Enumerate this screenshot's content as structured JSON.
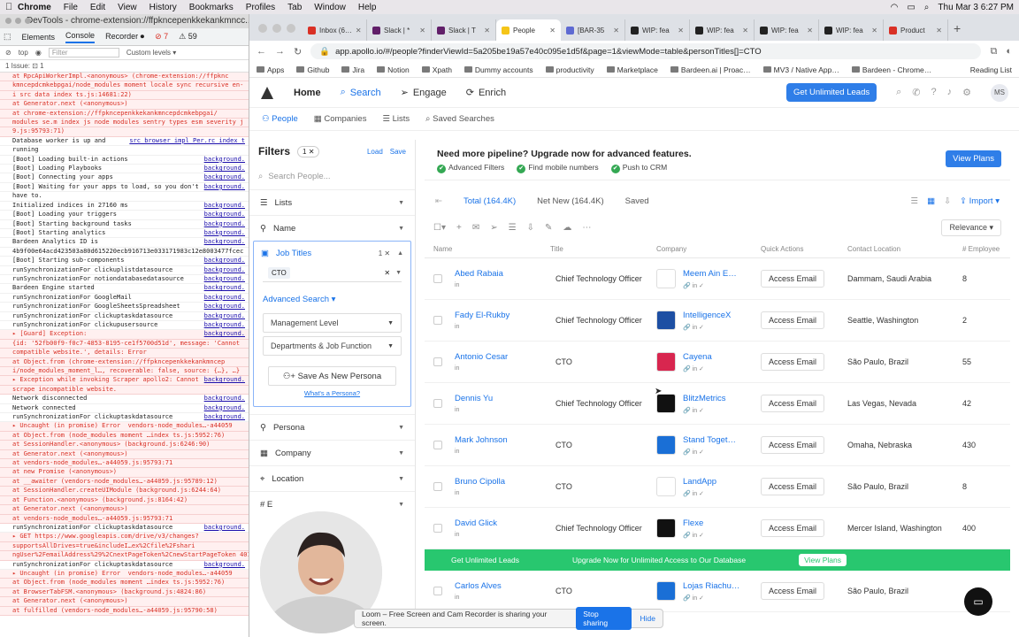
{
  "menubar": {
    "app": "Chrome",
    "items": [
      "File",
      "Edit",
      "View",
      "History",
      "Bookmarks",
      "Profiles",
      "Tab",
      "Window",
      "Help"
    ],
    "clock": "Thu Mar 3  6:27 PM"
  },
  "devtools": {
    "title": "DevTools - chrome-extension://ffpkncepenkkekankmncc...",
    "tabs": [
      "Elements",
      "Console",
      "Recorder ⏺"
    ],
    "active_tab": "Console",
    "error_count": "⊘ 7",
    "warn_count": "⚠ 59",
    "top": "top",
    "filter_placeholder": "Filter",
    "levels": "Custom levels ▾",
    "issues": "1 Issue: ⊡ 1",
    "log": [
      {
        "text": "at RpcApiWorkerImpl.<anonymous> (chrome-extension://ffpknc",
        "src": "",
        "err": true
      },
      {
        "text": "kmncepdcmkebpgai/node_modules moment locale sync recursive en-",
        "src": "",
        "err": true
      },
      {
        "text": "i src data index ts.js:14681:22)",
        "src": "",
        "err": true
      },
      {
        "text": "at Generator.next (<anonymous>)",
        "src": "",
        "err": true
      },
      {
        "text": "at chrome-extension://ffpkncepenkkekankmncepdcmkebpgai/",
        "src": "",
        "err": true
      },
      {
        "text": "modules se.m index js node modules sentry types esm severity j",
        "src": "",
        "err": true
      },
      {
        "text": "9.js:95793:71)",
        "src": "",
        "err": true
      },
      {
        "text": "Database worker is up and",
        "src": "src browser impl Per.rc index t",
        "err": false
      },
      {
        "text": "running",
        "src": "",
        "err": false
      },
      {
        "text": "[Boot] Loading built-in actions",
        "src": "background.",
        "err": false
      },
      {
        "text": "[Boot] Loading Playbooks",
        "src": "background.",
        "err": false
      },
      {
        "text": "[Boot] Connecting your apps",
        "src": "background.",
        "err": false
      },
      {
        "text": "[Boot] Waiting for your apps to load, so you don't",
        "src": "background.",
        "err": false
      },
      {
        "text": "have to.",
        "src": "",
        "err": false
      },
      {
        "text": "Initialized indices in 27160 ms",
        "src": "background.",
        "err": false
      },
      {
        "text": "[Boot] Loading your triggers",
        "src": "background.",
        "err": false
      },
      {
        "text": "[Boot] Starting background tasks",
        "src": "background.",
        "err": false
      },
      {
        "text": "[Boot] Starting analytics",
        "src": "background.",
        "err": false
      },
      {
        "text": "Bardeen Analytics ID is",
        "src": "background.",
        "err": false
      },
      {
        "text": "4b9f00e64acd423503a80d615220ecb916713e033171983c12e8003477fcec",
        "src": "",
        "err": false
      },
      {
        "text": "[Boot] Starting sub-components",
        "src": "background.",
        "err": false
      },
      {
        "text": "runSynchronizationFor clickuplistdatasource",
        "src": "background.",
        "err": false
      },
      {
        "text": "runSynchronizationFor notiondatabasedatasource",
        "src": "background.",
        "err": false
      },
      {
        "text": "Bardeen Engine started",
        "src": "background.",
        "err": false
      },
      {
        "text": "runSynchronizationFor GoogleMail",
        "src": "background.",
        "err": false
      },
      {
        "text": "runSynchronizationFor GoogleSheetsSpreadsheet",
        "src": "background.",
        "err": false
      },
      {
        "text": "runSynchronizationFor clickuptaskdatasource",
        "src": "background.",
        "err": false
      },
      {
        "text": "runSynchronizationFor clickupusersource",
        "src": "background.",
        "err": false
      },
      {
        "text": "▸ [Guard] Exception:",
        "src": "background.",
        "err": true
      },
      {
        "text": "{id: '52fb00f9-f0c7-4853-8195-ce1f5700d51d', message: 'Cannot",
        "src": "",
        "err": true
      },
      {
        "text": "compatible website.', details: Error",
        "src": "",
        "err": true
      },
      {
        "text": "at Object.from (chrome-extension://ffpkncepenkkekankmncep",
        "src": "",
        "err": true
      },
      {
        "text": "i/node_modules_moment_l…, recoverable: false, source: {…}, …}",
        "src": "",
        "err": true
      },
      {
        "text": "▸ Exception while invoking Scraper apollo2: Cannot",
        "src": "background.",
        "err": true
      },
      {
        "text": "scrape incompatible website.",
        "src": "",
        "err": true
      },
      {
        "text": "Network disconnected",
        "src": "background.",
        "err": false
      },
      {
        "text": "Network connected",
        "src": "background.",
        "err": false
      },
      {
        "text": "runSynchronizationFor clickuptaskdatasource",
        "src": "background.",
        "err": false
      },
      {
        "text": "▸ Uncaught (in promise) Error  vendors-node_modules…-a44059",
        "src": "",
        "err": true
      },
      {
        "text": "at Object.from (node_modules moment …index ts.js:5952:76)",
        "src": "",
        "err": true
      },
      {
        "text": "at SessionHandler.<anonymous> (background.js:6246:90)",
        "src": "",
        "err": true
      },
      {
        "text": "at Generator.next (<anonymous>)",
        "src": "",
        "err": true
      },
      {
        "text": "at vendors-node_modules…-a44059.js:95793:71",
        "src": "",
        "err": true
      },
      {
        "text": "at new Promise (<anonymous>)",
        "src": "",
        "err": true
      },
      {
        "text": "at __awaiter (vendors-node_modules…-a44059.js:95789:12)",
        "src": "",
        "err": true
      },
      {
        "text": "at SessionHandler.createUIModule (background.js:6244:64)",
        "src": "",
        "err": true
      },
      {
        "text": "at Function.<anonymous> (background.js:8164:42)",
        "src": "",
        "err": true
      },
      {
        "text": "at Generator.next (<anonymous>)",
        "src": "",
        "err": true
      },
      {
        "text": "at vendors-node_modules…-a44059.js:95793:71",
        "src": "",
        "err": true
      },
      {
        "text": "runSynchronizationFor clickuptaskdatasource",
        "src": "background.",
        "err": false
      },
      {
        "text": "▸ GET https://www.googleapis.com/drive/v3/changes?",
        "src": "",
        "err": true
      },
      {
        "text": "supportsAllDrives=true&includeI…ex%2Cfile%2Fshari",
        "src": "",
        "err": true
      },
      {
        "text": "ngUser%2FemailAddress%29%2CnextPageToken%2CnewStartPageToken 401",
        "src": "",
        "err": true
      },
      {
        "text": "runSynchronizationFor clickuptaskdatasource",
        "src": "background.",
        "err": false
      },
      {
        "text": "▸ Uncaught (in promise) Error  vendors-node_modules…-a44059",
        "src": "",
        "err": true
      },
      {
        "text": "at Object.from (node_modules moment …index ts.js:5952:76)",
        "src": "",
        "err": true
      },
      {
        "text": "at BrowserTabFSM.<anonymous> (background.js:4824:86)",
        "src": "",
        "err": true
      },
      {
        "text": "at Generator.next (<anonymous>)",
        "src": "",
        "err": true
      },
      {
        "text": "at fulfilled (vendors-node_modules…-a44059.js:95790:58)",
        "src": "",
        "err": true
      }
    ]
  },
  "tabs": [
    {
      "label": "Inbox (6…",
      "color": "#d93025"
    },
    {
      "label": "Slack | *",
      "color": "#611f69"
    },
    {
      "label": "Slack | T",
      "color": "#611f69"
    },
    {
      "label": "People",
      "color": "#f5c518",
      "active": true
    },
    {
      "label": "[BAR-35",
      "color": "#5e6ad2"
    },
    {
      "label": "WIP: fea",
      "color": "#222"
    },
    {
      "label": "WIP: fea",
      "color": "#222"
    },
    {
      "label": "WIP: fea",
      "color": "#222"
    },
    {
      "label": "WIP: fea",
      "color": "#222"
    },
    {
      "label": "Product",
      "color": "#d93025"
    }
  ],
  "url": "app.apollo.io/#/people?finderViewId=5a205be19a57e40c095e1d5f&page=1&viewMode=table&personTitles[]=CTO",
  "bookmarks": [
    "Apps",
    "Github",
    "Jira",
    "Notion",
    "Xpath",
    "Dummy accounts",
    "productivity",
    "Marketplace",
    "Bardeen.ai | Proac…",
    "MV3 / Native App…",
    "Bardeen - Chrome…"
  ],
  "reading_list": "Reading List",
  "apollo": {
    "nav": [
      "Home",
      "Search",
      "Engage",
      "Enrich"
    ],
    "unlimited_leads": "Get Unlimited Leads",
    "avatar": "MS",
    "subnav": [
      "People",
      "Companies",
      "Lists",
      "Saved Searches"
    ]
  },
  "filters": {
    "title": "Filters",
    "count": "1 ✕",
    "load": "Load",
    "save": "Save",
    "search_placeholder": "Search People...",
    "lists": "Lists",
    "name": "Name",
    "job_titles": "Job Titles",
    "job_count": "1 ✕",
    "cto_tag": "CTO",
    "advanced": "Advanced Search ▾",
    "management": "Management Level",
    "departments": "Departments & Job Function",
    "save_persona": "Save As New Persona",
    "what_persona": "What's a Persona?",
    "persona": "Persona",
    "company": "Company",
    "location": "Location",
    "employees": "# E"
  },
  "upsell": {
    "title": "Need more pipeline? Upgrade now for advanced features.",
    "features": [
      "Advanced Filters",
      "Find mobile numbers",
      "Push to CRM"
    ],
    "view_plans": "View Plans"
  },
  "results_tabs": {
    "total": "Total (164.4K)",
    "net_new": "Net New (164.4K)",
    "saved": "Saved",
    "import": "Import",
    "relevance": "Relevance"
  },
  "table": {
    "headers": [
      "Name",
      "Title",
      "Company",
      "Quick Actions",
      "Contact Location",
      "# Employee"
    ],
    "rows": [
      {
        "name": "Abed Rabaia",
        "title": "Chief Technology Officer",
        "company": "Meem Ain E…",
        "logo": "#ffffff",
        "action": "Access Email",
        "location": "Dammam, Saudi Arabia",
        "employees": "8"
      },
      {
        "name": "Fady El-Rukby",
        "title": "Chief Technology Officer",
        "company": "IntelligenceX",
        "logo": "#1d4fa3",
        "action": "Access Email",
        "location": "Seattle, Washington",
        "employees": "2"
      },
      {
        "name": "Antonio Cesar",
        "title": "CTO",
        "company": "Cayena",
        "logo": "#d8264f",
        "action": "Access Email",
        "location": "São Paulo, Brazil",
        "employees": "55"
      },
      {
        "name": "Dennis Yu",
        "title": "Chief Technology Officer",
        "company": "BlitzMetrics",
        "logo": "#111111",
        "action": "Access Email",
        "location": "Las Vegas, Nevada",
        "employees": "42"
      },
      {
        "name": "Mark Johnson",
        "title": "CTO",
        "company": "Stand Toget…",
        "logo": "#1a6fd6",
        "action": "Access Email",
        "location": "Omaha, Nebraska",
        "employees": "430"
      },
      {
        "name": "Bruno Cipolla",
        "title": "CTO",
        "company": "LandApp",
        "logo": "#ffffff",
        "action": "Access Email",
        "location": "São Paulo, Brazil",
        "employees": "8"
      },
      {
        "name": "David Glick",
        "title": "Chief Technology Officer",
        "company": "Flexe",
        "logo": "#111111",
        "action": "Access Email",
        "location": "Mercer Island, Washington",
        "employees": "400"
      },
      {
        "name": "Carlos Alves",
        "title": "CTO",
        "company": "Lojas Riachu…",
        "logo": "#1a6fd6",
        "action": "Access Email",
        "location": "São Paulo, Brazil",
        "employees": ""
      }
    ]
  },
  "green_bar": {
    "left": "Get Unlimited Leads",
    "middle": "Upgrade Now for Unlimited Access to Our Database",
    "button": "View Plans"
  },
  "share_bar": {
    "text": "Loom – Free Screen and Cam Recorder is sharing your screen.",
    "stop": "Stop sharing",
    "hide": "Hide"
  }
}
